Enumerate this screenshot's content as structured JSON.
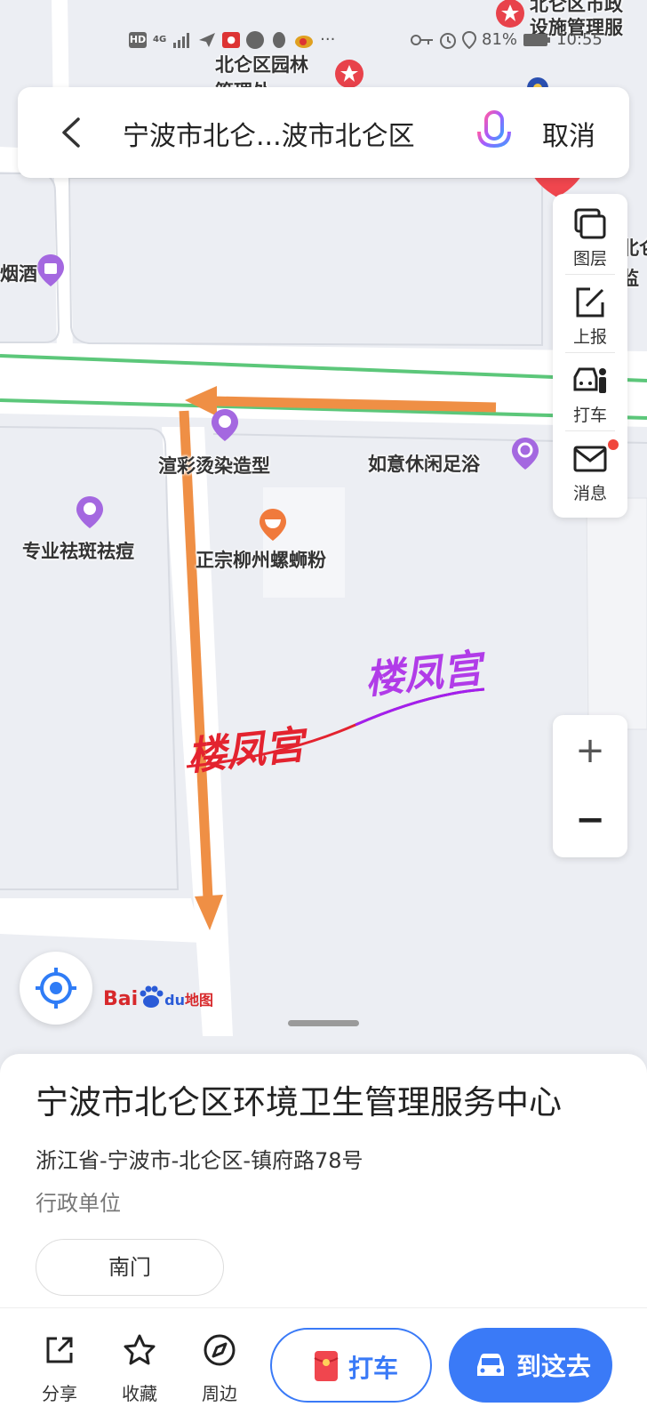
{
  "status_bar": {
    "network": "4G",
    "battery": "81%",
    "time": "10:55"
  },
  "search": {
    "query": "宁波市北仑...波市北仑区",
    "cancel_label": "取消"
  },
  "map": {
    "pois": [
      {
        "name": "北仑区市政",
        "line2": "设施管理服",
        "kind": "government"
      },
      {
        "name": "北仑区园林",
        "line2": "管理处",
        "kind": "government"
      },
      {
        "name": "烟酒",
        "kind": "shop"
      },
      {
        "name": "渲彩烫染造型",
        "kind": "beauty"
      },
      {
        "name": "如意休闲足浴",
        "kind": "leisure"
      },
      {
        "name": "专业祛斑祛痘",
        "kind": "beauty"
      },
      {
        "name": "正宗柳州螺蛳粉",
        "kind": "food"
      },
      {
        "name": "北仑",
        "line2": "监",
        "kind": "partial"
      }
    ],
    "watermarks": [
      "楼凤宫",
      "楼凤宫"
    ],
    "logo": {
      "bai": "Bai",
      "du": "du",
      "map": "地图"
    }
  },
  "tools": [
    {
      "label": "图层",
      "icon": "layers-icon"
    },
    {
      "label": "上报",
      "icon": "report-edit-icon"
    },
    {
      "label": "打车",
      "icon": "taxi-person-icon"
    },
    {
      "label": "消息",
      "icon": "mail-icon",
      "badge": true
    }
  ],
  "zoom": {
    "in": "+",
    "out": "−"
  },
  "place": {
    "name": "宁波市北仑区环境卫生管理服务中心",
    "address": "浙江省-宁波市-北仑区-镇府路78号",
    "type": "行政单位",
    "gate": "南门"
  },
  "actions": {
    "share": "分享",
    "favorite": "收藏",
    "nearby": "周边",
    "taxi": "打车",
    "go": "到这去"
  },
  "colors": {
    "accent": "#3A7AF7",
    "arrow": "#EF8F45",
    "road_green": "#5CC77A",
    "poi_purple": "#A468E0",
    "poi_red": "#E8424B",
    "poi_orange": "#F07A3C"
  }
}
